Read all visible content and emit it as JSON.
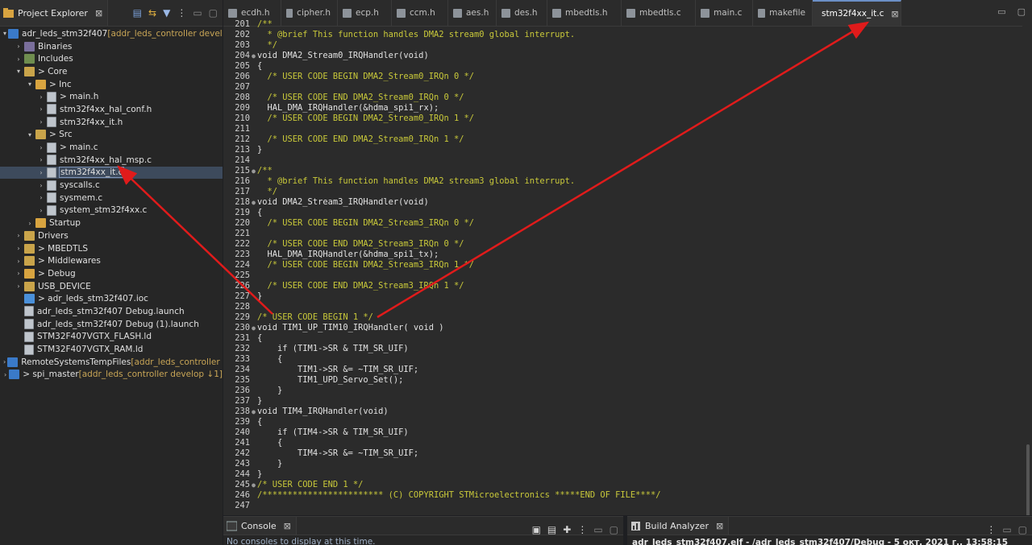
{
  "explorer": {
    "tab_label": "Project Explorer",
    "tree": [
      {
        "depth": 0,
        "arrow": "▾",
        "icon": "proj",
        "label": "adr_leds_stm32f407",
        "decor": " [addr_leds_controller develop"
      },
      {
        "depth": 1,
        "arrow": "›",
        "icon": "bin",
        "label": "Binaries",
        "decor": ""
      },
      {
        "depth": 1,
        "arrow": "›",
        "icon": "inc",
        "label": "Includes",
        "decor": ""
      },
      {
        "depth": 1,
        "arrow": "▾",
        "icon": "srcf",
        "label": "> Core",
        "decor": ""
      },
      {
        "depth": 2,
        "arrow": "▾",
        "icon": "folder",
        "label": "> Inc",
        "decor": ""
      },
      {
        "depth": 3,
        "arrow": "›",
        "icon": "file",
        "label": "> main.h",
        "decor": ""
      },
      {
        "depth": 3,
        "arrow": "›",
        "icon": "file",
        "label": "stm32f4xx_hal_conf.h",
        "decor": ""
      },
      {
        "depth": 3,
        "arrow": "›",
        "icon": "file",
        "label": "stm32f4xx_it.h",
        "decor": ""
      },
      {
        "depth": 2,
        "arrow": "▾",
        "icon": "srcf",
        "label": "> Src",
        "decor": ""
      },
      {
        "depth": 3,
        "arrow": "›",
        "icon": "file",
        "label": "> main.c",
        "decor": ""
      },
      {
        "depth": 3,
        "arrow": "›",
        "icon": "file",
        "label": "stm32f4xx_hal_msp.c",
        "decor": ""
      },
      {
        "depth": 3,
        "arrow": "›",
        "icon": "file",
        "label": "stm32f4xx_it.c",
        "decor": "",
        "selected": true
      },
      {
        "depth": 3,
        "arrow": "›",
        "icon": "file",
        "label": "syscalls.c",
        "decor": ""
      },
      {
        "depth": 3,
        "arrow": "›",
        "icon": "file",
        "label": "sysmem.c",
        "decor": ""
      },
      {
        "depth": 3,
        "arrow": "›",
        "icon": "file",
        "label": "system_stm32f4xx.c",
        "decor": ""
      },
      {
        "depth": 2,
        "arrow": "›",
        "icon": "folder",
        "label": "Startup",
        "decor": ""
      },
      {
        "depth": 1,
        "arrow": "›",
        "icon": "srcf",
        "label": "Drivers",
        "decor": ""
      },
      {
        "depth": 1,
        "arrow": "›",
        "icon": "srcf",
        "label": "> MBEDTLS",
        "decor": ""
      },
      {
        "depth": 1,
        "arrow": "›",
        "icon": "srcf",
        "label": "> Middlewares",
        "decor": ""
      },
      {
        "depth": 1,
        "arrow": "›",
        "icon": "folder",
        "label": "> Debug",
        "decor": ""
      },
      {
        "depth": 1,
        "arrow": "›",
        "icon": "srcf",
        "label": "USB_DEVICE",
        "decor": ""
      },
      {
        "depth": 1,
        "arrow": "",
        "icon": "ioc",
        "label": "> adr_leds_stm32f407.ioc",
        "decor": ""
      },
      {
        "depth": 1,
        "arrow": "",
        "icon": "file",
        "label": "adr_leds_stm32f407 Debug.launch",
        "decor": ""
      },
      {
        "depth": 1,
        "arrow": "",
        "icon": "file",
        "label": "adr_leds_stm32f407 Debug (1).launch",
        "decor": ""
      },
      {
        "depth": 1,
        "arrow": "",
        "icon": "file",
        "label": "STM32F407VGTX_FLASH.ld",
        "decor": ""
      },
      {
        "depth": 1,
        "arrow": "",
        "icon": "file",
        "label": "STM32F407VGTX_RAM.ld",
        "decor": ""
      },
      {
        "depth": 0,
        "arrow": "›",
        "icon": "proj",
        "label": "RemoteSystemsTempFiles",
        "decor": " [addr_leds_controller deve"
      },
      {
        "depth": 0,
        "arrow": "›",
        "icon": "proj",
        "label": "> spi_master",
        "decor": " [addr_leds_controller develop ↓1]"
      }
    ]
  },
  "editor": {
    "tabs": [
      {
        "label": "ecdh.h",
        "active": false
      },
      {
        "label": "cipher.h",
        "active": false
      },
      {
        "label": "ecp.h",
        "active": false
      },
      {
        "label": "ccm.h",
        "active": false
      },
      {
        "label": "aes.h",
        "active": false
      },
      {
        "label": "des.h",
        "active": false
      },
      {
        "label": "mbedtls.h",
        "active": false
      },
      {
        "label": "mbedtls.c",
        "active": false
      },
      {
        "label": "main.c",
        "active": false
      },
      {
        "label": "makefile",
        "active": false
      },
      {
        "label": "stm32f4xx_it.c",
        "active": true
      }
    ],
    "lines": [
      {
        "n": "201",
        "f": "",
        "t": "c",
        "s": "/**"
      },
      {
        "n": "202",
        "f": "",
        "t": "c",
        "s": "  * @brief This function handles DMA2 stream0 global interrupt."
      },
      {
        "n": "203",
        "f": "",
        "t": "c",
        "s": "  */"
      },
      {
        "n": "204",
        "f": "●",
        "t": "p",
        "s": "void DMA2_Stream0_IRQHandler(void)"
      },
      {
        "n": "205",
        "f": "",
        "t": "p",
        "s": "{"
      },
      {
        "n": "206",
        "f": "",
        "t": "c",
        "s": "  /* USER CODE BEGIN DMA2_Stream0_IRQn 0 */"
      },
      {
        "n": "207",
        "f": "",
        "t": "p",
        "s": ""
      },
      {
        "n": "208",
        "f": "",
        "t": "c",
        "s": "  /* USER CODE END DMA2_Stream0_IRQn 0 */"
      },
      {
        "n": "209",
        "f": "",
        "t": "p",
        "s": "  HAL_DMA_IRQHandler(&hdma_spi1_rx);"
      },
      {
        "n": "210",
        "f": "",
        "t": "c",
        "s": "  /* USER CODE BEGIN DMA2_Stream0_IRQn 1 */"
      },
      {
        "n": "211",
        "f": "",
        "t": "p",
        "s": ""
      },
      {
        "n": "212",
        "f": "",
        "t": "c",
        "s": "  /* USER CODE END DMA2_Stream0_IRQn 1 */"
      },
      {
        "n": "213",
        "f": "",
        "t": "p",
        "s": "}"
      },
      {
        "n": "214",
        "f": "",
        "t": "p",
        "s": ""
      },
      {
        "n": "215",
        "f": "●",
        "t": "c",
        "s": "/**"
      },
      {
        "n": "216",
        "f": "",
        "t": "c",
        "s": "  * @brief This function handles DMA2 stream3 global interrupt."
      },
      {
        "n": "217",
        "f": "",
        "t": "c",
        "s": "  */"
      },
      {
        "n": "218",
        "f": "●",
        "t": "p",
        "s": "void DMA2_Stream3_IRQHandler(void)"
      },
      {
        "n": "219",
        "f": "",
        "t": "p",
        "s": "{"
      },
      {
        "n": "220",
        "f": "",
        "t": "c",
        "s": "  /* USER CODE BEGIN DMA2_Stream3_IRQn 0 */"
      },
      {
        "n": "221",
        "f": "",
        "t": "p",
        "s": ""
      },
      {
        "n": "222",
        "f": "",
        "t": "c",
        "s": "  /* USER CODE END DMA2_Stream3_IRQn 0 */"
      },
      {
        "n": "223",
        "f": "",
        "t": "p",
        "s": "  HAL_DMA_IRQHandler(&hdma_spi1_tx);"
      },
      {
        "n": "224",
        "f": "",
        "t": "c",
        "s": "  /* USER CODE BEGIN DMA2_Stream3_IRQn 1 */"
      },
      {
        "n": "225",
        "f": "",
        "t": "p",
        "s": ""
      },
      {
        "n": "226",
        "f": "",
        "t": "c",
        "s": "  /* USER CODE END DMA2_Stream3_IRQn 1 */"
      },
      {
        "n": "227",
        "f": "",
        "t": "p",
        "s": "}"
      },
      {
        "n": "228",
        "f": "",
        "t": "p",
        "s": ""
      },
      {
        "n": "229",
        "f": "",
        "t": "c",
        "s": "/* USER CODE BEGIN 1 */"
      },
      {
        "n": "230",
        "f": "●",
        "t": "p",
        "s": "void TIM1_UP_TIM10_IRQHandler( void )"
      },
      {
        "n": "231",
        "f": "",
        "t": "p",
        "s": "{"
      },
      {
        "n": "232",
        "f": "",
        "t": "p",
        "s": "    if (TIM1->SR & TIM_SR_UIF)"
      },
      {
        "n": "233",
        "f": "",
        "t": "p",
        "s": "    {"
      },
      {
        "n": "234",
        "f": "",
        "t": "p",
        "s": "        TIM1->SR &= ~TIM_SR_UIF;"
      },
      {
        "n": "235",
        "f": "",
        "t": "p",
        "s": "        TIM1_UPD_Servo_Set();"
      },
      {
        "n": "236",
        "f": "",
        "t": "p",
        "s": "    }"
      },
      {
        "n": "237",
        "f": "",
        "t": "p",
        "s": "}"
      },
      {
        "n": "238",
        "f": "●",
        "t": "p",
        "s": "void TIM4_IRQHandler(void)"
      },
      {
        "n": "239",
        "f": "",
        "t": "p",
        "s": "{"
      },
      {
        "n": "240",
        "f": "",
        "t": "p",
        "s": "    if (TIM4->SR & TIM_SR_UIF)"
      },
      {
        "n": "241",
        "f": "",
        "t": "p",
        "s": "    {"
      },
      {
        "n": "242",
        "f": "",
        "t": "p",
        "s": "        TIM4->SR &= ~TIM_SR_UIF;"
      },
      {
        "n": "243",
        "f": "",
        "t": "p",
        "s": "    }"
      },
      {
        "n": "244",
        "f": "",
        "t": "p",
        "s": "}"
      },
      {
        "n": "245",
        "f": "●",
        "t": "c",
        "s": "/* USER CODE END 1 */"
      },
      {
        "n": "246",
        "f": "",
        "t": "c",
        "s": "/************************ (C) COPYRIGHT STMicroelectronics *****END OF FILE****/"
      },
      {
        "n": "247",
        "f": "",
        "t": "p",
        "s": ""
      }
    ]
  },
  "console": {
    "tab_label": "Console",
    "message": "No consoles to display at this time."
  },
  "build": {
    "tab_label": "Build Analyzer",
    "status": "adr_leds_stm32f407.elf - /adr_leds_stm32f407/Debug - 5 окт. 2021 г., 13:58:15"
  },
  "colors": {
    "annotation_arrow": "#e01b1b",
    "comment": "#c9c93a"
  }
}
